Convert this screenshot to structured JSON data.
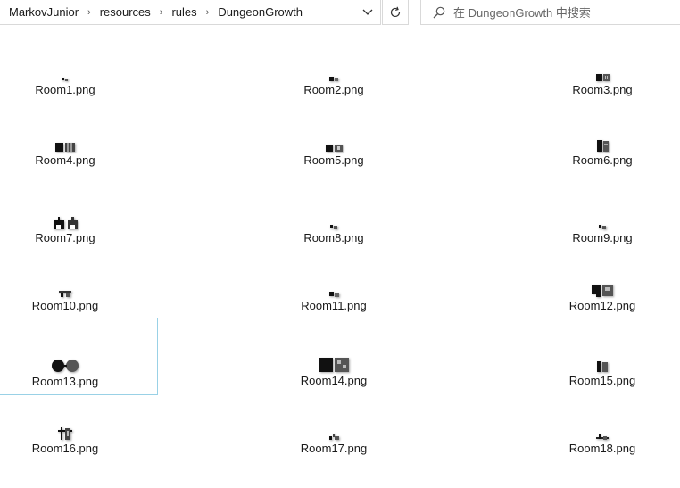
{
  "breadcrumb": [
    "MarkovJunior",
    "resources",
    "rules",
    "DungeonGrowth"
  ],
  "search": {
    "placeholder": "在 DungeonGrowth 中搜索"
  },
  "icons": {
    "dropdown": "chevron-down-icon",
    "refresh": "refresh-icon",
    "search": "search-icon"
  },
  "selected_file": "Room13.png",
  "files": [
    {
      "name": "Room1.png"
    },
    {
      "name": "Room2.png"
    },
    {
      "name": "Room3.png"
    },
    {
      "name": "Room4.png"
    },
    {
      "name": "Room5.png"
    },
    {
      "name": "Room6.png"
    },
    {
      "name": "Room7.png"
    },
    {
      "name": "Room8.png"
    },
    {
      "name": "Room9.png"
    },
    {
      "name": "Room10.png"
    },
    {
      "name": "Room11.png"
    },
    {
      "name": "Room12.png"
    },
    {
      "name": "Room13.png"
    },
    {
      "name": "Room14.png"
    },
    {
      "name": "Room15.png"
    },
    {
      "name": "Room16.png"
    },
    {
      "name": "Room17.png"
    },
    {
      "name": "Room18.png"
    }
  ]
}
